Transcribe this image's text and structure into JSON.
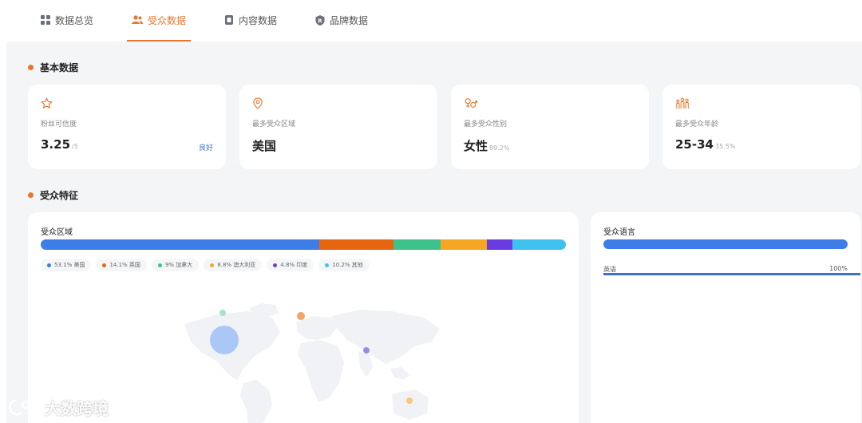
{
  "tabs": [
    {
      "label": "数据总览",
      "active": false,
      "icon": "grid-icon"
    },
    {
      "label": "受众数据",
      "active": true,
      "icon": "users-icon"
    },
    {
      "label": "内容数据",
      "active": false,
      "icon": "document-icon"
    },
    {
      "label": "品牌数据",
      "active": false,
      "icon": "brand-r-icon"
    }
  ],
  "basic": {
    "title": "基本数据",
    "cards": [
      {
        "icon": "star-icon",
        "label": "粉丝可信度",
        "value": "3.25",
        "sub": "/5",
        "tag": "良好"
      },
      {
        "icon": "location-pin-icon",
        "label": "最多受众区域",
        "value": "美国",
        "sub": "",
        "tag": ""
      },
      {
        "icon": "gender-icon",
        "label": "最多受众性别",
        "value": "女性",
        "sub": "89.2%",
        "tag": ""
      },
      {
        "icon": "age-people-icon",
        "label": "最多受众年龄",
        "value": "25-34",
        "sub": "35.5%",
        "tag": ""
      }
    ]
  },
  "audience": {
    "title": "受众特征",
    "region": {
      "title": "受众区域",
      "segments": [
        {
          "label": "53.1% 美国",
          "value": 53.1,
          "color": "#3d7de8"
        },
        {
          "label": "14.1% 英国",
          "value": 14.1,
          "color": "#e8650f"
        },
        {
          "label": "9% 加拿大",
          "value": 9.0,
          "color": "#3cc28a"
        },
        {
          "label": "8.8% 澳大利亚",
          "value": 8.8,
          "color": "#f5a623"
        },
        {
          "label": "4.8% 印度",
          "value": 4.8,
          "color": "#6a3be0"
        },
        {
          "label": "10.2% 其他",
          "value": 10.2,
          "color": "#3fc1ee"
        }
      ]
    },
    "language": {
      "title": "受众语言",
      "bar_color": "#3d7de8",
      "rows": [
        {
          "name": "英语",
          "pct": "100%",
          "value": 100
        }
      ]
    }
  },
  "watermark": {
    "text": "大数跨境"
  }
}
